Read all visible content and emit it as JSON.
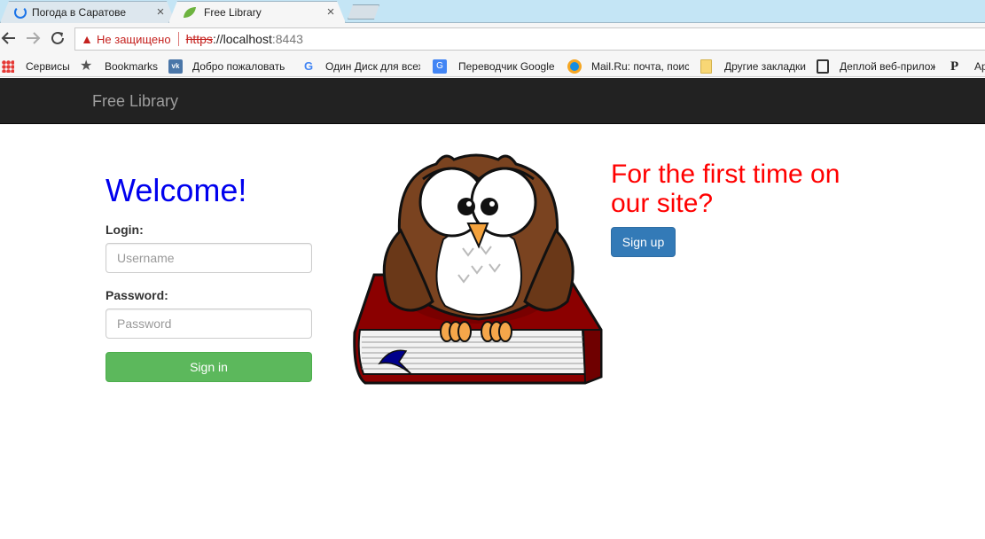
{
  "browser": {
    "tabs": [
      {
        "title": "Погода в Саратове",
        "active": false
      },
      {
        "title": "Free Library",
        "active": true
      }
    ],
    "address": {
      "security_text": "Не защищено",
      "scheme": "https",
      "host": "://localhost",
      "port": ":8443"
    },
    "bookmarks": [
      {
        "label": "Сервисы",
        "icon": "apps-grid-icon"
      },
      {
        "label": "Bookmarks",
        "icon": "star-icon"
      },
      {
        "label": "Добро пожаловать",
        "icon": "vk-icon"
      },
      {
        "label": "Один Диск для всех",
        "icon": "google-icon"
      },
      {
        "label": "Переводчик Google",
        "icon": "translate-icon"
      },
      {
        "label": "Mail.Ru: почта, поис",
        "icon": "mailru-icon"
      },
      {
        "label": "Другие закладки",
        "icon": "folder-icon"
      },
      {
        "label": "Деплой веб-прилож",
        "icon": "film-icon"
      },
      {
        "label": "Ар",
        "icon": "p-icon"
      }
    ]
  },
  "page": {
    "brand": "Free Library",
    "welcome": "Welcome!",
    "login_label": "Login:",
    "login_placeholder": "Username",
    "password_label": "Password:",
    "password_placeholder": "Password",
    "signin_label": "Sign in",
    "first_time": "For the first time on our site?",
    "signup_label": "Sign up"
  },
  "colors": {
    "navbar": "#222222",
    "welcome": "#0000ee",
    "first_time": "#ff0000",
    "signin": "#5cb85c",
    "signup": "#337ab7"
  }
}
